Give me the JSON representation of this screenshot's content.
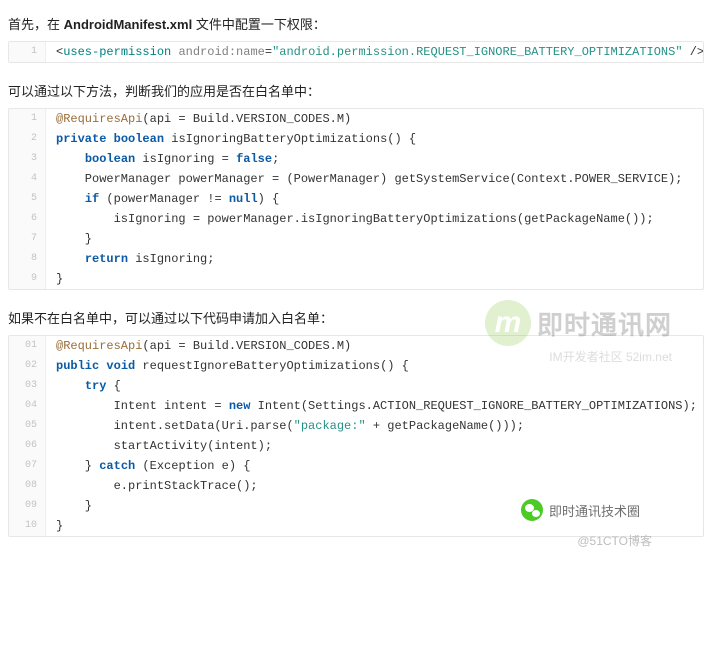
{
  "sections": [
    {
      "heading_html": "首先，在 <strong>AndroidManifest.xml</strong> 文件中配置一下权限：",
      "code": [
        [
          {
            "cls": "tk-punct",
            "t": "<"
          },
          {
            "cls": "tk-tag",
            "t": "uses-permission"
          },
          {
            "cls": "tk-plain",
            "t": " "
          },
          {
            "cls": "tk-attr",
            "t": "android:name"
          },
          {
            "cls": "tk-punct",
            "t": "="
          },
          {
            "cls": "tk-str",
            "t": "\"android.permission.REQUEST_IGNORE_BATTERY_OPTIMIZATIONS\""
          },
          {
            "cls": "tk-plain",
            "t": " "
          },
          {
            "cls": "tk-punct",
            "t": "/>"
          }
        ]
      ]
    },
    {
      "heading_html": "可以通过以下方法，判断我们的应用是否在白名单中：",
      "code": [
        [
          {
            "cls": "tk-ann",
            "t": "@RequiresApi"
          },
          {
            "cls": "tk-plain",
            "t": "(api = Build.VERSION_CODES.M)"
          }
        ],
        [
          {
            "cls": "tk-key",
            "t": "private"
          },
          {
            "cls": "tk-plain",
            "t": " "
          },
          {
            "cls": "tk-key",
            "t": "boolean"
          },
          {
            "cls": "tk-plain",
            "t": " isIgnoringBatteryOptimizations() {"
          }
        ],
        [
          {
            "cls": "tk-plain",
            "t": "    "
          },
          {
            "cls": "tk-key",
            "t": "boolean"
          },
          {
            "cls": "tk-plain",
            "t": " isIgnoring = "
          },
          {
            "cls": "tk-key",
            "t": "false"
          },
          {
            "cls": "tk-plain",
            "t": ";"
          }
        ],
        [
          {
            "cls": "tk-plain",
            "t": "    PowerManager powerManager = (PowerManager) getSystemService(Context.POWER_SERVICE);"
          }
        ],
        [
          {
            "cls": "tk-plain",
            "t": "    "
          },
          {
            "cls": "tk-key",
            "t": "if"
          },
          {
            "cls": "tk-plain",
            "t": " (powerManager != "
          },
          {
            "cls": "tk-key",
            "t": "null"
          },
          {
            "cls": "tk-plain",
            "t": ") {"
          }
        ],
        [
          {
            "cls": "tk-plain",
            "t": "        isIgnoring = powerManager.isIgnoringBatteryOptimizations(getPackageName());"
          }
        ],
        [
          {
            "cls": "tk-plain",
            "t": "    }"
          }
        ],
        [
          {
            "cls": "tk-plain",
            "t": "    "
          },
          {
            "cls": "tk-key",
            "t": "return"
          },
          {
            "cls": "tk-plain",
            "t": " isIgnoring;"
          }
        ],
        [
          {
            "cls": "tk-plain",
            "t": "}"
          }
        ]
      ]
    },
    {
      "heading_html": "如果不在白名单中，可以通过以下代码申请加入白名单：",
      "pad": 2,
      "code": [
        [
          {
            "cls": "tk-ann",
            "t": "@RequiresApi"
          },
          {
            "cls": "tk-plain",
            "t": "(api = Build.VERSION_CODES.M)"
          }
        ],
        [
          {
            "cls": "tk-key",
            "t": "public"
          },
          {
            "cls": "tk-plain",
            "t": " "
          },
          {
            "cls": "tk-key",
            "t": "void"
          },
          {
            "cls": "tk-plain",
            "t": " requestIgnoreBatteryOptimizations() {"
          }
        ],
        [
          {
            "cls": "tk-plain",
            "t": "    "
          },
          {
            "cls": "tk-key",
            "t": "try"
          },
          {
            "cls": "tk-plain",
            "t": " {"
          }
        ],
        [
          {
            "cls": "tk-plain",
            "t": "        Intent intent = "
          },
          {
            "cls": "tk-key",
            "t": "new"
          },
          {
            "cls": "tk-plain",
            "t": " Intent(Settings.ACTION_REQUEST_IGNORE_BATTERY_OPTIMIZATIONS);"
          }
        ],
        [
          {
            "cls": "tk-plain",
            "t": "        intent.setData(Uri.parse("
          },
          {
            "cls": "tk-str",
            "t": "\"package:\""
          },
          {
            "cls": "tk-plain",
            "t": " + getPackageName()));"
          }
        ],
        [
          {
            "cls": "tk-plain",
            "t": "        startActivity(intent);"
          }
        ],
        [
          {
            "cls": "tk-plain",
            "t": "    } "
          },
          {
            "cls": "tk-key",
            "t": "catch"
          },
          {
            "cls": "tk-plain",
            "t": " (Exception e) {"
          }
        ],
        [
          {
            "cls": "tk-plain",
            "t": "        e.printStackTrace();"
          }
        ],
        [
          {
            "cls": "tk-plain",
            "t": "    }"
          }
        ],
        [
          {
            "cls": "tk-plain",
            "t": "}"
          }
        ]
      ]
    }
  ],
  "watermark_logo": {
    "glyph": "m",
    "title": "即时通讯网",
    "sub": "IM开发者社区  52im.net"
  },
  "wechat_label": "即时通讯技术圈",
  "footer_watermark": "@51CTO博客"
}
